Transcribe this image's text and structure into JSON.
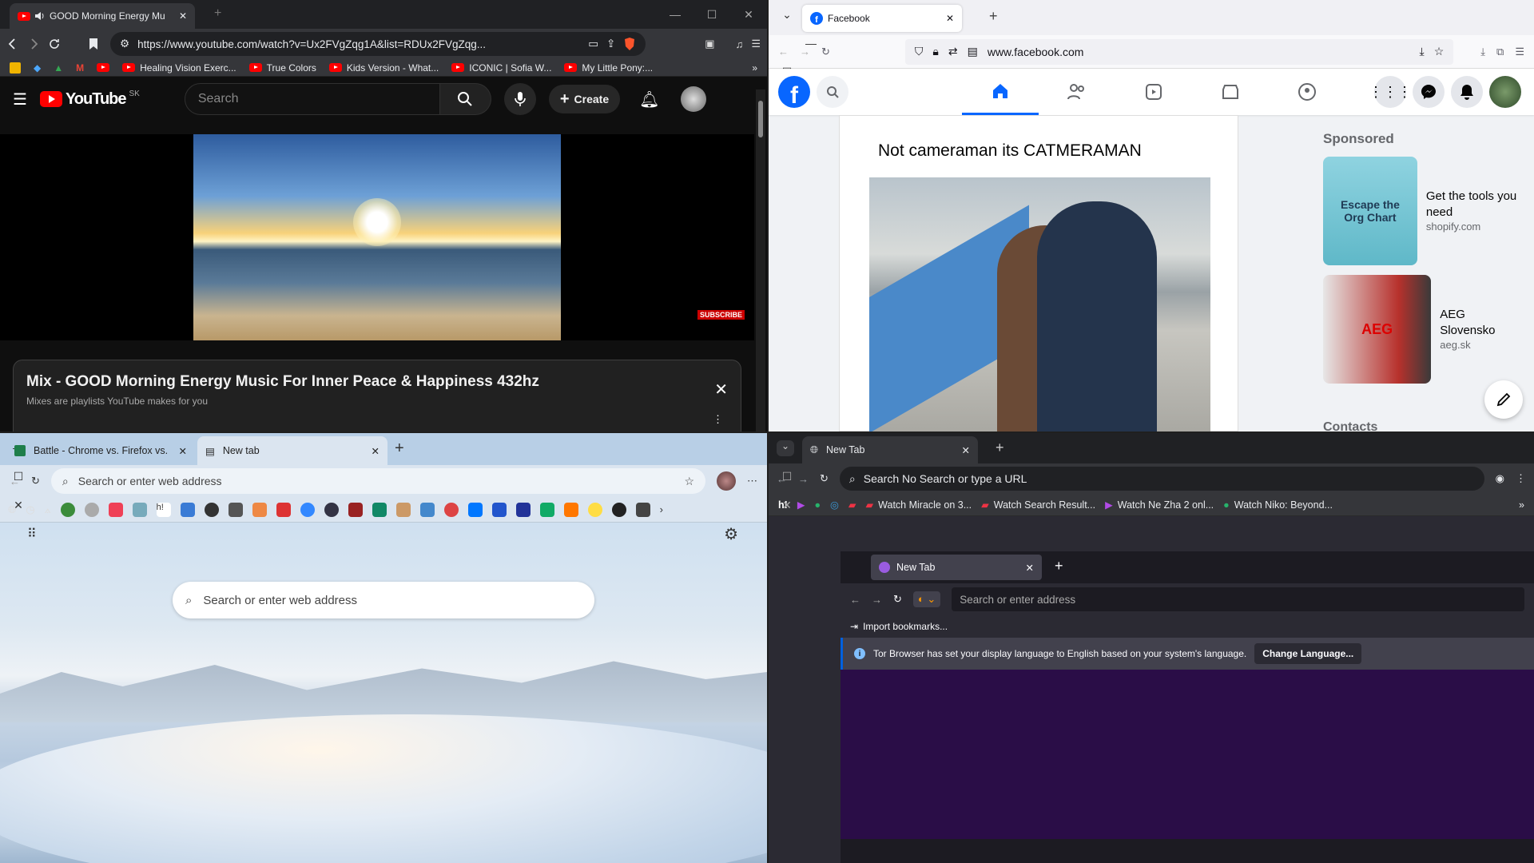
{
  "brave": {
    "tab_title": "GOOD Morning Energy Mu",
    "url": "https://www.youtube.com/watch?v=Ux2FVgZqg1A&list=RDUx2FVgZqg...",
    "bookmarks": [
      "Healing Vision Exerc...",
      "True Colors",
      "Kids Version - What...",
      "ICONIC | Sofia W...",
      "My Little Pony:..."
    ],
    "youtube": {
      "logo": "YouTube",
      "region": "SK",
      "search_placeholder": "Search",
      "create_label": "Create",
      "subscribe_badge": "SUBSCRIBE",
      "mix_title": "Mix - GOOD Morning Energy Music For Inner Peace & Happiness 432hz",
      "mix_subtitle": "Mixes are playlists YouTube makes for you"
    }
  },
  "firefox": {
    "tab_title": "Facebook",
    "url": "www.facebook.com",
    "post_text": "Not cameraman its CATMERAMAN",
    "sponsored_heading": "Sponsored",
    "ads": [
      {
        "title": "Get the tools you need",
        "domain": "shopify.com",
        "image_text": "Escape the Org Chart"
      },
      {
        "title": "AEG Slovensko",
        "domain": "aeg.sk",
        "image_text": "AEG"
      }
    ],
    "contacts_heading": "Contacts",
    "brand_color": "#0866ff"
  },
  "edge": {
    "tab_inactive": "Battle - Chrome vs. Firefox vs. E",
    "tab_active": "New tab",
    "address_placeholder": "Search or enter web address",
    "search_placeholder": "Search or enter web address"
  },
  "chrome": {
    "tab_title": "New Tab",
    "omnibox": "Search No Search or type a URL",
    "bookmarks": [
      "Watch Miracle on 3...",
      "Watch Search Result...",
      "Watch Ne Zha 2 onl...",
      "Watch Niko: Beyond..."
    ]
  },
  "tor": {
    "tab_title": "New Tab",
    "address_placeholder": "Search or enter address",
    "import_label": "Import bookmarks...",
    "notice": "Tor Browser has set your display language to English based on your system's language.",
    "change_button": "Change Language..."
  }
}
